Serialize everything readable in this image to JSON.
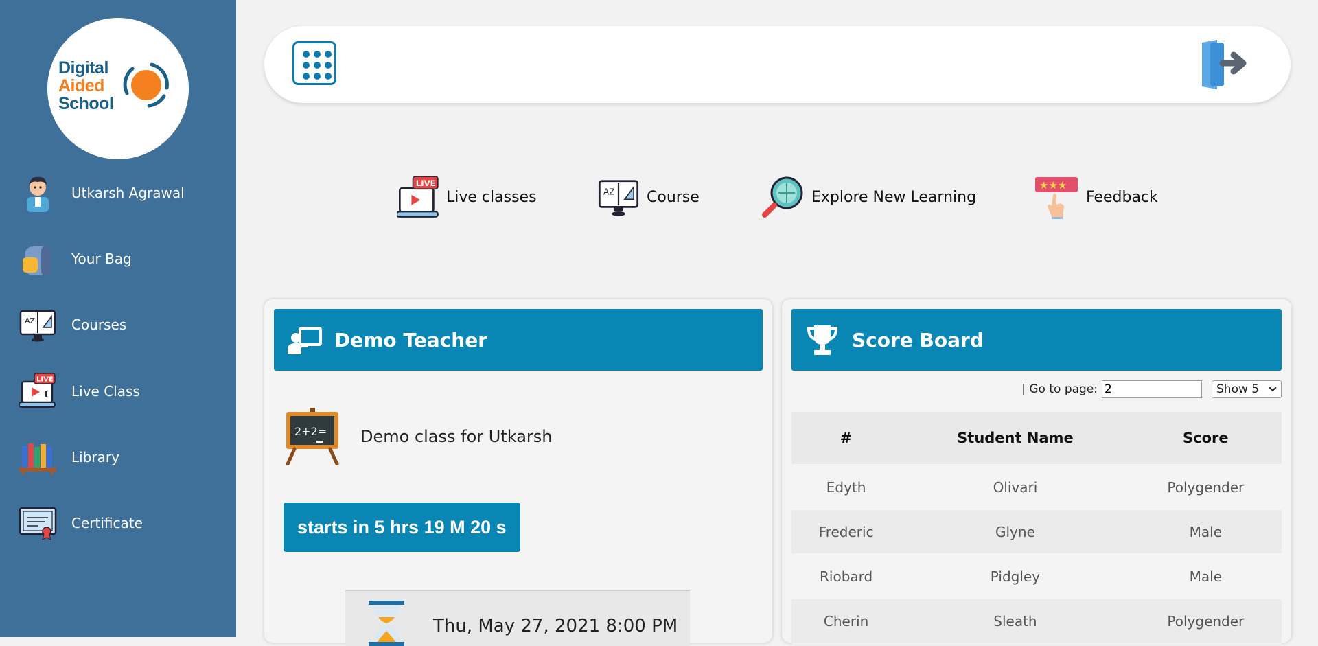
{
  "logo": {
    "line1": "Digital",
    "line2": "Aided",
    "line3": "School"
  },
  "sidebar": {
    "items": [
      {
        "label": "Utkarsh Agrawal",
        "icon": "student-avatar-icon"
      },
      {
        "label": "Your Bag",
        "icon": "backpack-icon"
      },
      {
        "label": "Courses",
        "icon": "book-monitor-icon"
      },
      {
        "label": "Live Class",
        "icon": "live-laptop-icon"
      },
      {
        "label": "Library",
        "icon": "books-shelf-icon"
      },
      {
        "label": "Certificate",
        "icon": "certificate-icon"
      }
    ]
  },
  "topbar": {
    "menu_icon": "grid-menu-icon",
    "logout_icon": "logout-door-icon"
  },
  "quick_nav": {
    "items": [
      {
        "label": "Live classes",
        "icon": "live-laptop-icon"
      },
      {
        "label": "Course",
        "icon": "book-monitor-icon"
      },
      {
        "label": "Explore New Learning",
        "icon": "magnifier-globe-icon"
      },
      {
        "label": "Feedback",
        "icon": "rating-stars-hand-icon"
      }
    ]
  },
  "teacher_card": {
    "title": "Demo Teacher",
    "class_name": "Demo class for Utkarsh",
    "board_text": "2+2=",
    "countdown": "starts in 5 hrs 19 M 20 s",
    "datetime": "Thu, May 27, 2021 8:00 PM"
  },
  "score_card": {
    "title": "Score Board",
    "goto_label": "| Go to page:",
    "goto_value": "2",
    "show_value": "Show 5",
    "columns": [
      "#",
      "Student Name",
      "Score"
    ],
    "rows": [
      [
        "Edyth",
        "Olivari",
        "Polygender"
      ],
      [
        "Frederic",
        "Glyne",
        "Male"
      ],
      [
        "Riobard",
        "Pidgley",
        "Male"
      ],
      [
        "Cherin",
        "Sleath",
        "Polygender"
      ]
    ]
  },
  "colors": {
    "sidebar": "#3f7099",
    "accent": "#0a86b5",
    "logo_orange": "#f4801f",
    "logo_blue": "#1a5f86"
  }
}
